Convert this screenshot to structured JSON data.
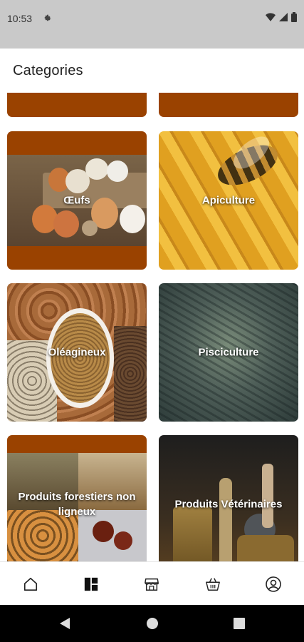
{
  "status_bar": {
    "time": "10:53"
  },
  "header": {
    "title": "Categories"
  },
  "categories": [
    {
      "label": "Œufs"
    },
    {
      "label": "Apiculture"
    },
    {
      "label": "Oléagineux"
    },
    {
      "label": "Pisciculture"
    },
    {
      "label": "Produits forestiers non ligneux"
    },
    {
      "label": "Produits Vétérinaires"
    }
  ],
  "bottom_nav": {
    "items": [
      "home-icon",
      "categories-icon",
      "store-icon",
      "basket-icon",
      "account-icon"
    ],
    "active": "categories-icon"
  },
  "colors": {
    "accent_brown": "#9a4200",
    "status_bar_bg": "#c9c9c9",
    "system_nav_bg": "#000000"
  }
}
